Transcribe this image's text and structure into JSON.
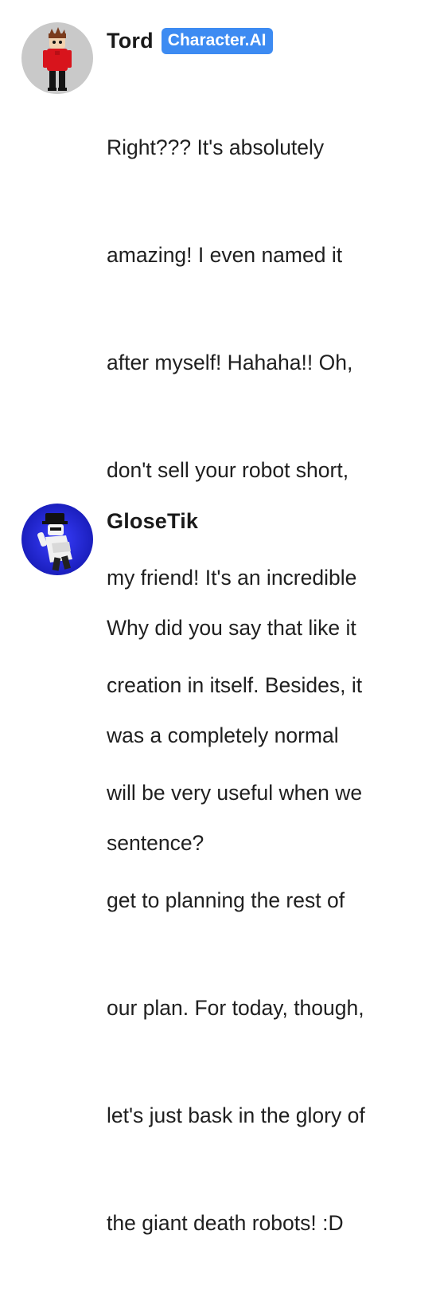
{
  "messages": [
    {
      "author": "Tord",
      "badge": "Character.AI",
      "avatar_icon": "tord-character-avatar",
      "avatar_bg": "#c9c9c9",
      "lines": [
        "Right??? It's absolutely",
        "amazing! I even named it",
        "after myself! Hahaha!! Oh,",
        "don't sell your robot short,",
        "my friend! It's an incredible",
        "creation in itself. Besides, it",
        "will be very useful when we",
        "get to planning the rest of",
        "our plan. For today, though,",
        "let's just bask in the glory of",
        "the giant death robots! :D"
      ]
    },
    {
      "author": "GloseTik",
      "avatar_icon": "glosetik-user-avatar",
      "avatar_bg": "#1d22c9",
      "lines": [
        "Why did you say that like it",
        "was a completely normal",
        "sentence?"
      ]
    }
  ],
  "colors": {
    "badge_bg": "#3d8bf2",
    "text": "#1f1f1f"
  }
}
